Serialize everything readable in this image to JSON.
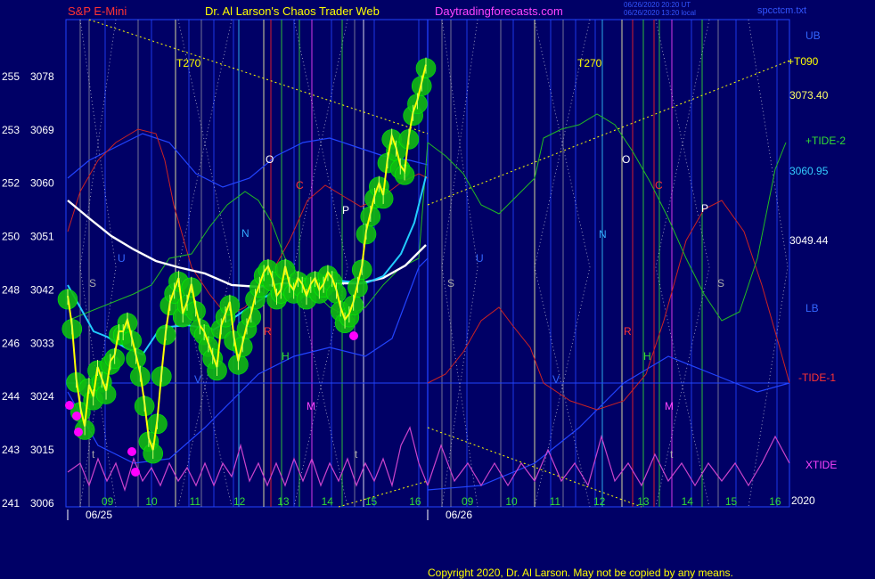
{
  "header": {
    "instrument": "S&P E-Mini",
    "site_title": "Dr. Al Larson's Chaos Trader Web",
    "site_url": "Daytradingforecasts.com",
    "timestamp_1": "06/26/2020 20:20 UT",
    "timestamp_2": "06/26/2020 13:20 local",
    "file_name": "spcctcm.txt"
  },
  "footer": {
    "copyright": "Copyright 2020, Dr. Al Larson. May not be copied by any means."
  },
  "chart_data": {
    "type": "line",
    "y_ticks": [
      {
        "left": "255",
        "right": "3078",
        "value": 3078
      },
      {
        "left": "253",
        "right": "3069",
        "value": 3069
      },
      {
        "left": "252",
        "right": "3060",
        "value": 3060
      },
      {
        "left": "250",
        "right": "3051",
        "value": 3051
      },
      {
        "left": "248",
        "right": "3042",
        "value": 3042
      },
      {
        "left": "246",
        "right": "3033",
        "value": 3033
      },
      {
        "left": "244",
        "right": "3024",
        "value": 3024
      },
      {
        "left": "243",
        "right": "3015",
        "value": 3015
      },
      {
        "left": "241",
        "right": "3006",
        "value": 3006
      }
    ],
    "ylim": [
      3006,
      3087
    ],
    "day1_hours": [
      "09",
      "10",
      "11",
      "12",
      "13",
      "14",
      "15",
      "16"
    ],
    "day2_hours": [
      "09",
      "10",
      "11",
      "12",
      "13",
      "14",
      "15",
      "16"
    ],
    "dates": [
      "06/25",
      "06/26"
    ],
    "right_labels": [
      {
        "text": "UB",
        "color": "#3366ff"
      },
      {
        "text": "+T090",
        "color": "#ffff00"
      },
      {
        "text": "3073.40",
        "color": "#ffff66"
      },
      {
        "text": "+TIDE-2",
        "color": "#33dd33"
      },
      {
        "text": "3060.95",
        "color": "#33ccff"
      },
      {
        "text": "3049.44",
        "color": "#ffffff"
      },
      {
        "text": "LB",
        "color": "#3366ff"
      },
      {
        "text": "-TIDE-1",
        "color": "#ff3333"
      },
      {
        "text": "XTIDE",
        "color": "#ff44ff"
      },
      {
        "text": "2020",
        "color": "#ffffff"
      }
    ],
    "marker_labels": [
      {
        "text": "T270",
        "color": "#ffff00"
      },
      {
        "text": "T270",
        "color": "#ffff00"
      },
      {
        "text": "O",
        "color": "#ffffff"
      },
      {
        "text": "O",
        "color": "#ffffff"
      },
      {
        "text": "C",
        "color": "#ff3333"
      },
      {
        "text": "C",
        "color": "#ff3333"
      },
      {
        "text": "P",
        "color": "#ffffff"
      },
      {
        "text": "P",
        "color": "#ffffff"
      },
      {
        "text": "N",
        "color": "#33aaff"
      },
      {
        "text": "N",
        "color": "#33aaff"
      },
      {
        "text": "U",
        "color": "#3366ff"
      },
      {
        "text": "U",
        "color": "#3366ff"
      },
      {
        "text": "S",
        "color": "#aaaaaa"
      },
      {
        "text": "S",
        "color": "#aaaaaa"
      },
      {
        "text": "S",
        "color": "#aaaaaa"
      },
      {
        "text": "R",
        "color": "#ff3333"
      },
      {
        "text": "R",
        "color": "#ff3333"
      },
      {
        "text": "H",
        "color": "#33dd33"
      },
      {
        "text": "H",
        "color": "#33dd33"
      },
      {
        "text": "M",
        "color": "#ff44ff"
      },
      {
        "text": "M",
        "color": "#ff44ff"
      },
      {
        "text": "V",
        "color": "#3366ff"
      },
      {
        "text": "V",
        "color": "#3366ff"
      },
      {
        "text": "t",
        "color": "#aaaaaa"
      },
      {
        "text": "t",
        "color": "#aaaaaa"
      },
      {
        "text": "t",
        "color": "#aaaaaa"
      }
    ],
    "price_series": [
      3041,
      3036,
      3027,
      3022,
      3019,
      3026,
      3024,
      3029,
      3027,
      3025,
      3030,
      3031,
      3035,
      3035,
      3037,
      3034,
      3031,
      3028,
      3023,
      3017,
      3015,
      3020,
      3028,
      3035,
      3040,
      3042,
      3044,
      3038,
      3040,
      3043,
      3039,
      3036,
      3035,
      3033,
      3031,
      3029,
      3036,
      3038,
      3040,
      3034,
      3030,
      3033,
      3036,
      3038,
      3041,
      3043,
      3045,
      3046,
      3044,
      3041,
      3042,
      3046,
      3043,
      3042,
      3044,
      3043,
      3041,
      3043,
      3044,
      3042,
      3043,
      3045,
      3044,
      3042,
      3039,
      3037,
      3038,
      3040,
      3043,
      3046,
      3052,
      3055,
      3058,
      3060,
      3058,
      3064,
      3068,
      3066,
      3063,
      3062,
      3068,
      3072,
      3074,
      3077,
      3080
    ],
    "series_colors": {
      "price": "#ffff00",
      "bands": "#11bb11",
      "band_outline": "#00ff00",
      "avg_white": "#ffffff",
      "avg_cyan": "#22ccff",
      "tide_red": "#cc2222",
      "tide_green": "#22bb22",
      "xtide": "#cc44cc",
      "bounds": "#2244ff",
      "low_marker": "#ff00ff"
    }
  }
}
